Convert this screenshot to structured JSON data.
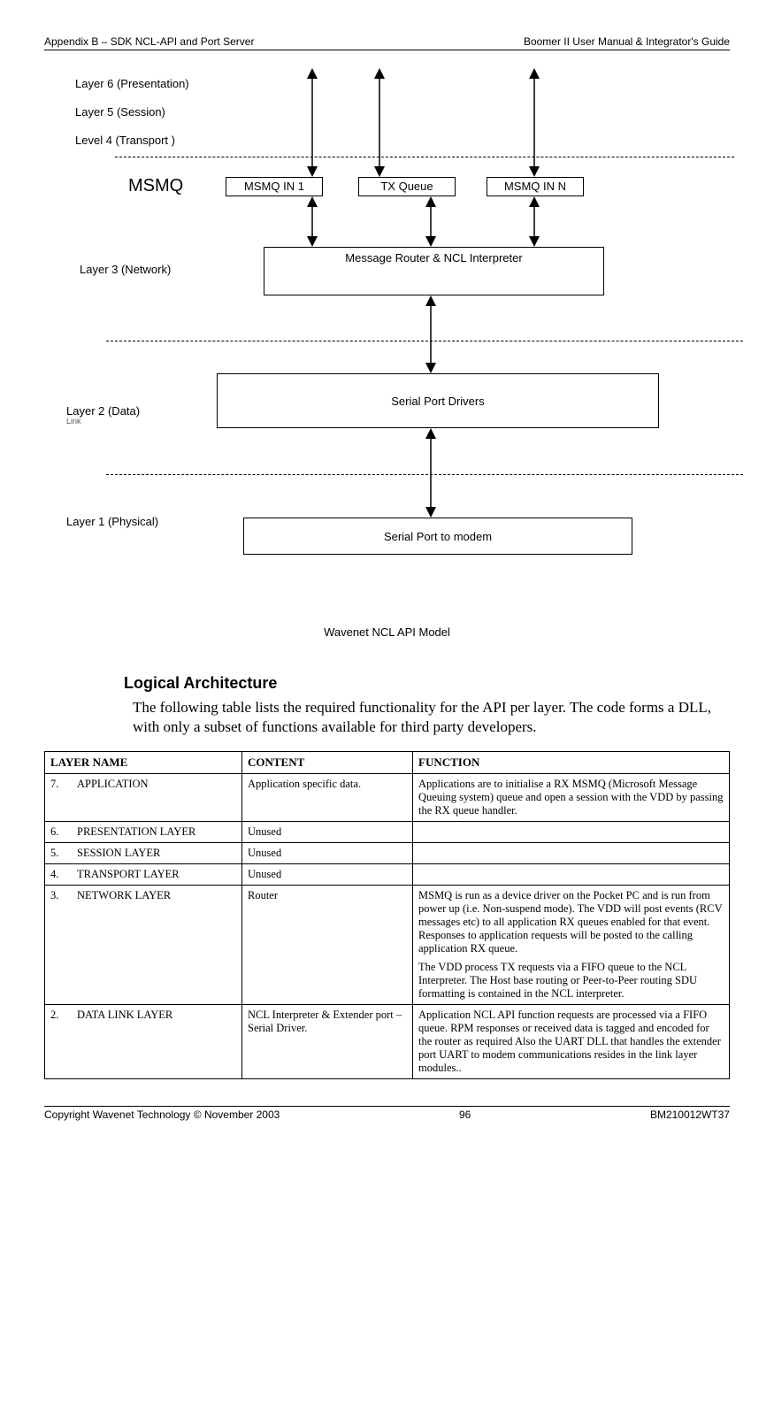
{
  "header": {
    "left": "Appendix B – SDK NCL-API and Port Server",
    "right": "Boomer II User Manual & Integrator's Guide"
  },
  "footer": {
    "left": "Copyright Wavenet Technology © November 2003",
    "center": "96",
    "right": "BM210012WT37"
  },
  "diagram": {
    "layer6": "Layer 6 (Presentation)",
    "layer5": "Layer 5 (Session)",
    "level4": "Level 4 (Transport )",
    "msmq": "MSMQ",
    "msmq_in_1": "MSMQ IN 1",
    "tx_queue": "TX Queue",
    "msmq_in_n": "MSMQ IN N",
    "layer3": "Layer 3  (Network)",
    "router_box": "Message Router & NCL Interpreter",
    "layer2_a": "Layer 2 (Data)",
    "layer2_b": "Link",
    "serial_drivers": "Serial Port Drivers",
    "layer1": "Layer 1 (Physical)",
    "serial_port": "Serial Port  to modem"
  },
  "caption": "Wavenet NCL API Model",
  "section_title": "Logical Architecture",
  "intro": "The following table lists the required functionality for the API per layer. The code forms a DLL, with only a subset of functions available for third party developers.",
  "table": {
    "headers": {
      "layer": "LAYER NAME",
      "content": "CONTENT",
      "function": "FUNCTION"
    },
    "rows": [
      {
        "num": "7.",
        "name": "APPLICATION",
        "content": "Application specific data.",
        "function": [
          "Applications are to initialise a RX MSMQ (Microsoft Message Queuing system) queue and open a session with the VDD by passing the RX queue handler."
        ]
      },
      {
        "num": "6.",
        "name": "PRESENTATION LAYER",
        "content": "Unused",
        "function": [
          ""
        ]
      },
      {
        "num": "5.",
        "name": "SESSION LAYER",
        "content": "Unused",
        "function": [
          ""
        ]
      },
      {
        "num": "4.",
        "name": "TRANSPORT LAYER",
        "content": "Unused",
        "function": [
          ""
        ]
      },
      {
        "num": "3.",
        "name": "NETWORK LAYER",
        "content": "Router",
        "function": [
          "MSMQ is run as a device driver on the Pocket PC and is run from power up (i.e. Non-suspend mode). The VDD will post events (RCV messages etc) to all application RX queues enabled for that event. Responses to application requests will be posted to the calling application RX queue.",
          "The VDD process TX requests via a FIFO queue to the NCL Interpreter. The Host base routing or Peer-to-Peer routing SDU formatting is contained in the NCL interpreter."
        ]
      },
      {
        "num": "2.",
        "name": "DATA LINK LAYER",
        "content": "NCL Interpreter & Extender port – Serial Driver.",
        "function": [
          "Application NCL API function requests are processed via a FIFO queue. RPM responses or received data is tagged and encoded for the router as required Also the UART DLL that handles the extender port UART to modem communications resides in the link layer modules.."
        ]
      }
    ]
  }
}
